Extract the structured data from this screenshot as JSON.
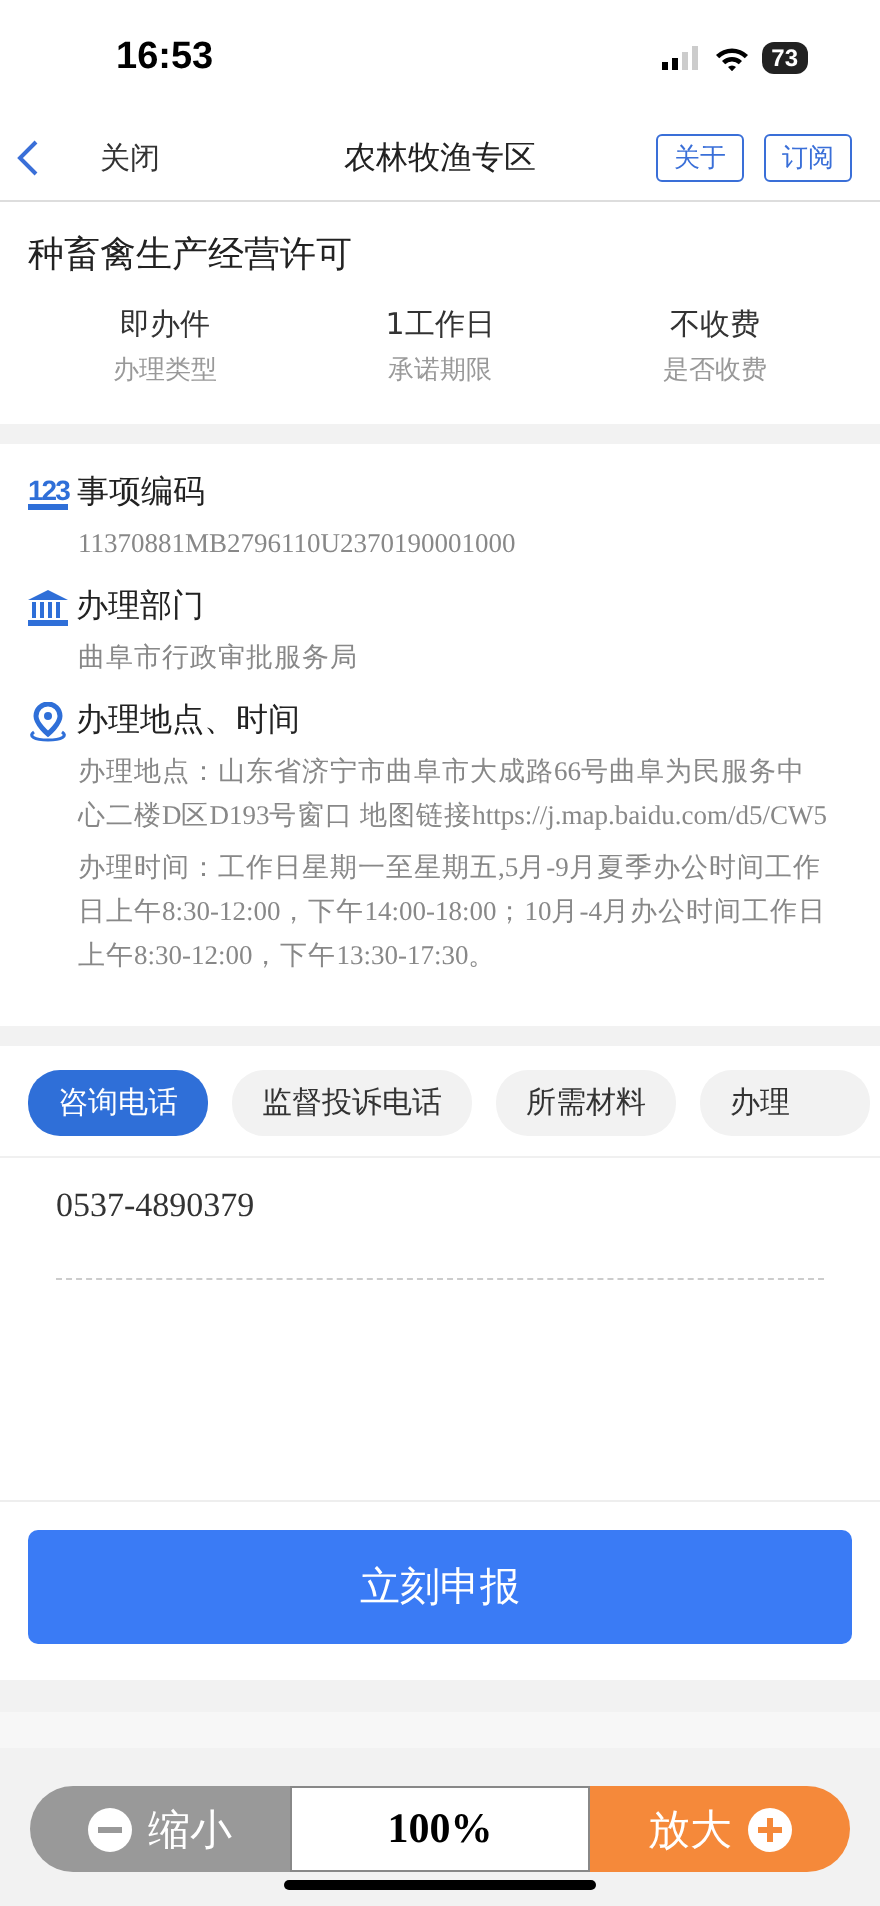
{
  "status_bar": {
    "time": "16:53",
    "battery": "73"
  },
  "nav": {
    "back": "关闭",
    "title": "农林牧渔专区",
    "buttons": [
      "关于",
      "订阅"
    ]
  },
  "item": {
    "title": "种畜禽生产经营许可",
    "facts": [
      {
        "value": "即办件",
        "label": "办理类型"
      },
      {
        "value": "1工作日",
        "label": "承诺期限"
      },
      {
        "value": "不收费",
        "label": "是否收费"
      }
    ]
  },
  "details": [
    {
      "kind": "code",
      "badge": "123",
      "heading": "事项编码",
      "lines": [
        "11370881MB2796110U2370190001000"
      ]
    },
    {
      "kind": "department",
      "heading": "办理部门",
      "lines": [
        "曲阜市行政审批服务局"
      ]
    },
    {
      "kind": "location",
      "heading": "办理地点、时间",
      "lines": [
        "办理地点：山东省济宁市曲阜市大成路66号曲阜为民服务中心二楼D区D193号窗口 地图链接https://j.map.baidu.com/d5/CW5",
        "办理时间：工作日星期一至星期五,5月-9月夏季办公时间工作日上午8:30-12:00，下午14:00-18:00；10月-4月办公时间工作日上午8:30-12:00，下午13:30-17:30。"
      ]
    }
  ],
  "tabs": [
    {
      "label": "咨询电话",
      "selected": true
    },
    {
      "label": "监督投诉电话",
      "selected": false
    },
    {
      "label": "所需材料",
      "selected": false
    },
    {
      "label": "办理",
      "selected": false
    }
  ],
  "tab_content": "0537-4890379",
  "apply_button": "立刻申报",
  "zoom_bar": {
    "zoom_out": "缩小",
    "value": "100%",
    "zoom_in": "放大"
  }
}
